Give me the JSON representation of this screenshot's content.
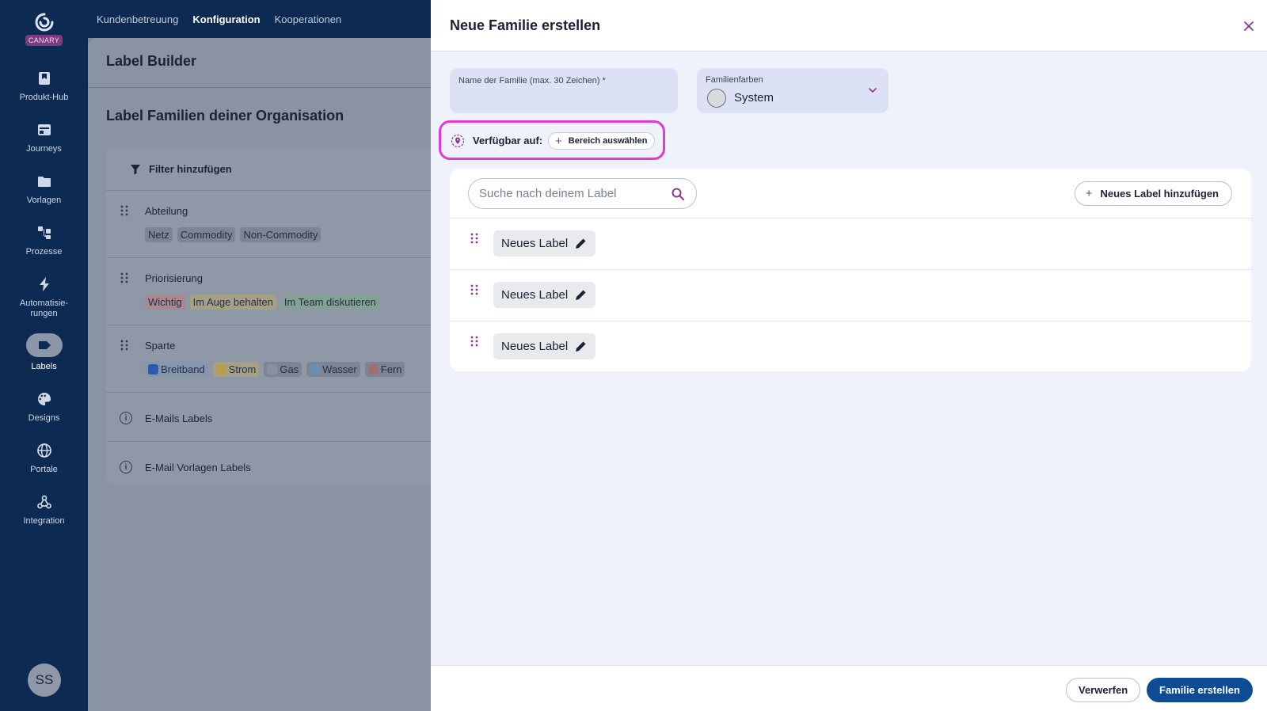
{
  "app": {
    "brand_badge": "CANARY"
  },
  "topnav": {
    "items": [
      "Kundenbetreuung",
      "Konfiguration",
      "Kooperationen"
    ],
    "active_index": 1
  },
  "sidebar": {
    "items": [
      {
        "label": "Produkt-Hub",
        "icon": "bookmark-icon"
      },
      {
        "label": "Journeys",
        "icon": "layout-icon"
      },
      {
        "label": "Vorlagen",
        "icon": "folder-icon"
      },
      {
        "label": "Prozesse",
        "icon": "flow-icon"
      },
      {
        "label": "Automatisie-\nrungen",
        "icon": "bolt-icon"
      },
      {
        "label": "Labels",
        "icon": "label-icon",
        "active": true
      },
      {
        "label": "Designs",
        "icon": "palette-icon"
      },
      {
        "label": "Portale",
        "icon": "globe-icon"
      },
      {
        "label": "Integration",
        "icon": "webhook-icon"
      }
    ],
    "avatar_initials": "SS"
  },
  "page": {
    "title": "Label Builder",
    "section_title": "Label Familien deiner Organisation",
    "filter_label": "Filter hinzufügen",
    "families": [
      {
        "name": "Abteilung",
        "chips": [
          {
            "label": "Netz",
            "tone": "gray"
          },
          {
            "label": "Commodity",
            "tone": "gray"
          },
          {
            "label": "Non-Commodity",
            "tone": "gray"
          }
        ]
      },
      {
        "name": "Priorisierung",
        "chips": [
          {
            "label": "Wichtig",
            "tone": "red"
          },
          {
            "label": "Im Auge behalten",
            "tone": "yellow"
          },
          {
            "label": "Im Team diskutieren",
            "tone": "green"
          }
        ]
      },
      {
        "name": "Sparte",
        "chips": [
          {
            "label": "Breitband",
            "tone": "blue"
          },
          {
            "label": "Strom",
            "tone": "yellow"
          },
          {
            "label": "Gas",
            "tone": "gray"
          },
          {
            "label": "Wasser",
            "tone": "gray"
          },
          {
            "label": "Fern",
            "tone": "gray"
          }
        ]
      }
    ],
    "info_rows": [
      "E-Mails Labels",
      "E-Mail Vorlagen Labels"
    ]
  },
  "drawer": {
    "title": "Neue Familie erstellen",
    "name_field": {
      "label": "Name der Familie (max. 30 Zeichen) *",
      "value": ""
    },
    "color_field": {
      "label": "Familienfarben",
      "value": "System"
    },
    "available": {
      "label": "Verfügbar auf:",
      "button": "Bereich auswählen"
    },
    "search_placeholder": "Suche nach deinem Label",
    "add_label_button": "Neues Label hinzufügen",
    "labels": [
      "Neues Label",
      "Neues Label",
      "Neues Label"
    ],
    "discard_button": "Verwerfen",
    "create_button": "Familie erstellen"
  },
  "colors": {
    "accent": "#0f4c96",
    "sidebar": "#0c2a52",
    "highlight": "#e03ad7"
  }
}
